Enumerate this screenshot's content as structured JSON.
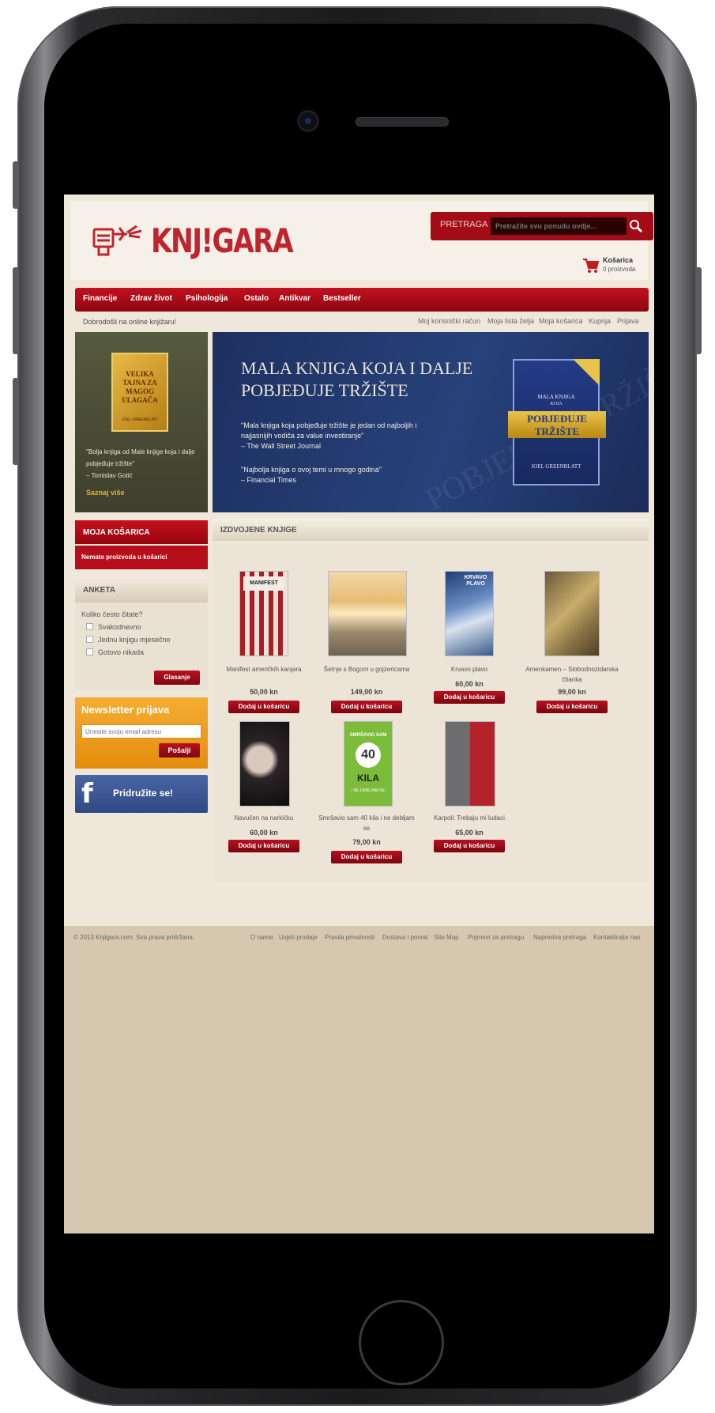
{
  "header": {
    "logo_text": "KNJ!GARA",
    "search": {
      "label": "PRETRAGA",
      "placeholder": "Pretražite svu ponudu ovdje..."
    },
    "cart": {
      "title": "Košarica",
      "count": "0 proizvoda"
    }
  },
  "nav": {
    "items": [
      {
        "label": "Financije"
      },
      {
        "label": "Zdrav život"
      },
      {
        "label": "Psihologija"
      },
      {
        "label": "Ostalo"
      },
      {
        "label": "Antikvar"
      },
      {
        "label": "Bestseller"
      }
    ]
  },
  "welcome": "Dobrodošli na online knjižaru!",
  "top_links": [
    "Moj korisnički račun",
    "Moja lista želja",
    "Moja košarica",
    "Kupnja",
    "Prijava"
  ],
  "promo": {
    "book_title": "VELIKA TAJNA ZA MAGOG ULAGAČA",
    "book_author": "JOEL GREENBLATT",
    "quote": "\"Bolja knjiga od Male knjige koja i dalje pobjeđuje tržište\"",
    "quote_author": "– Tomislav Gotić",
    "link": "Saznaj više"
  },
  "banner": {
    "title": "MALA KNJIGA KOJA I DALJE POBJEĐUJE TRŽIŠTE",
    "quote1": "\"Mala knjiga koja pobjeđuje tržište je jedan od najboljih i najjasnijih vodiča za value investiranje\"",
    "source1": "– The Wall Street Journal",
    "quote2": "\"Najbolja knjiga o ovoj temi u mnogo godina\"",
    "source2": "– Financial Times",
    "book_small": "MALA KNJIGA",
    "book_mid": "KOJA",
    "book_big": "POBJEĐUJE TRŽIŠTE",
    "book_author": "JOEL GREENBLATT",
    "watermark": "POBJEĐUJE TRŽIŠTE"
  },
  "cart_box": {
    "title": "MOJA KOŠARICA",
    "empty": "Nemate proizvoda u košarici"
  },
  "poll": {
    "title": "ANKETA",
    "question": "Koliko često čitate?",
    "options": [
      "Svakodnevno",
      "Jednu knjigu mjesečno",
      "Gotovo nikada"
    ],
    "vote": "Glasanje"
  },
  "newsletter": {
    "title": "Newsletter prijava",
    "placeholder": "Unesite svoju email adresu",
    "send": "Pošalji"
  },
  "facebook": {
    "label": "Pridružite se!"
  },
  "products_heading": "IZDVOJENE KNJIGE",
  "products": [
    {
      "name": "Manifest američkih kanjara",
      "price": "50,00 kn",
      "button": "Dodaj u košaricu"
    },
    {
      "name": "Šetnje s Bogom u gojzericama",
      "price": "149,00 kn",
      "button": "Dodaj u košaricu"
    },
    {
      "name": "Krvavo plavo",
      "price": "60,00 kn",
      "button": "Dodaj u košaricu"
    },
    {
      "name": "Amenkamen – Slobodnozidarska čitanka",
      "price": "99,00 kn",
      "button": "Dodaj u košaricu"
    },
    {
      "name": "Navučen na narkićku",
      "price": "60,00 kn",
      "button": "Dodaj u košaricu"
    },
    {
      "name": "Smršavio sam 40 kila i ne debljam se",
      "price": "79,00 kn",
      "button": "Dodaj u košaricu"
    },
    {
      "name": "Karpoli: Trebaju mi ludaci",
      "price": "65,00 kn",
      "button": "Dodaj u košaricu"
    }
  ],
  "covers": {
    "manifest": "MANIFEST",
    "krvavo_plavo": "KRVAVO PLAVO",
    "kila_top": "SMRŠAVIO SAM",
    "kila_num": "40",
    "kila_word": "KILA",
    "kila_bottom": "I NE DEBLJAM SE"
  },
  "footer": {
    "copyright": "© 2013 Knjigara.com. Sva prava pridržana.",
    "links": [
      "O nama",
      "Uvjeti prodaje",
      "Pravila privatnosti",
      "Dostava i povrat",
      "Site Map",
      "Pojmovi za pretragu",
      "Napredna pretraga",
      "Kontaktirajte nas"
    ]
  },
  "colors": {
    "brand_red": "#b0101d",
    "background": "#efe7da",
    "newsletter_orange": "#f4ad33",
    "facebook_blue": "#3b5998"
  }
}
